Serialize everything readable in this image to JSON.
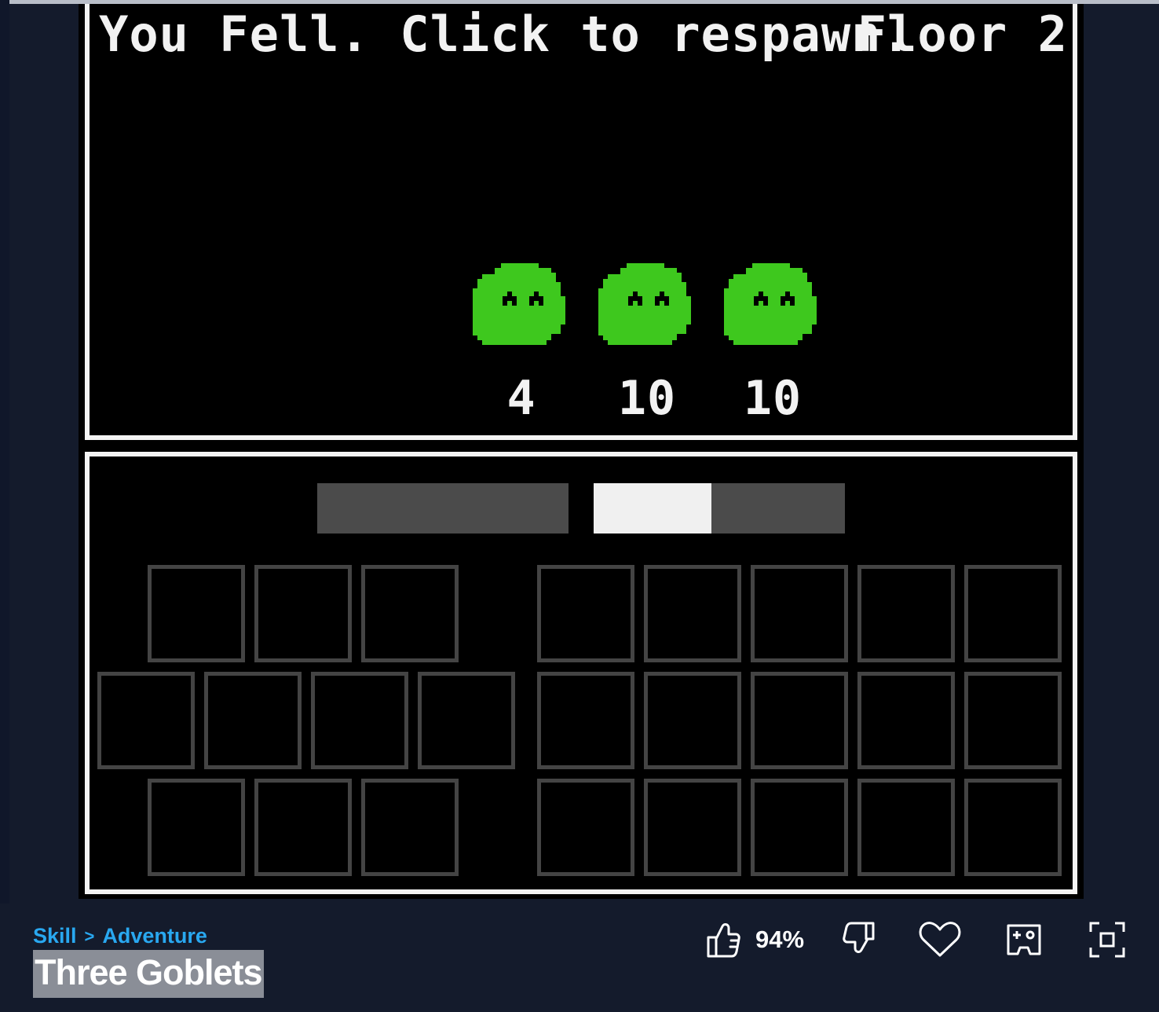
{
  "game": {
    "status_text": "You Fell. Click to respawn.",
    "floor_text": "Floor 2",
    "enemies": [
      {
        "type": "green-slime",
        "count": "4"
      },
      {
        "type": "green-slime",
        "count": "10"
      },
      {
        "type": "green-slime",
        "count": "10"
      }
    ],
    "bars": [
      {
        "fill": 0.0
      },
      {
        "fill": 0.47
      }
    ],
    "colors": {
      "slime": "#3ec81e",
      "panel_border": "#f4f4f4",
      "slot_border": "#444444",
      "bar_track": "#4b4b4b",
      "bar_fill": "#f0f0f0"
    }
  },
  "footer": {
    "breadcrumb": {
      "category": "Skill",
      "separator": ">",
      "subcategory": "Adventure"
    },
    "title": "Three Goblets",
    "like_percent": "94%",
    "icons": [
      "thumbs-up-icon",
      "thumbs-down-icon",
      "heart-icon",
      "gamepad-icon",
      "fullscreen-icon"
    ]
  }
}
